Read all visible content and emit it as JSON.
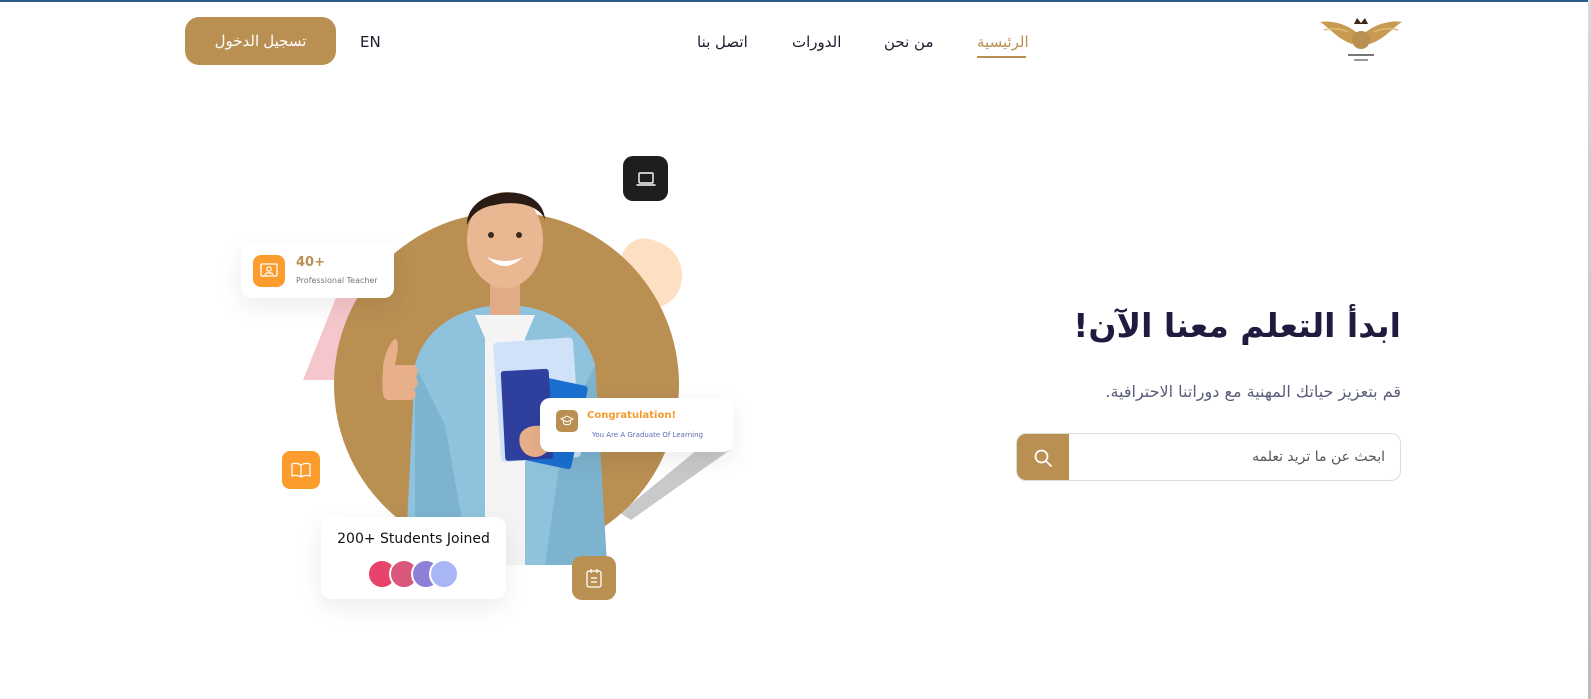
{
  "header": {
    "logo_name": "crown-wings-logo",
    "nav": [
      {
        "label": "الرئيسية",
        "active": true
      },
      {
        "label": "من نحن",
        "active": false
      },
      {
        "label": "الدورات",
        "active": false
      },
      {
        "label": "اتصل بنا",
        "active": false
      }
    ],
    "lang": "EN",
    "login_label": "تسجيل الدخول"
  },
  "hero": {
    "title": "ابدأ التعلم معنا الآن!",
    "subtitle": "قم بتعزيز حياتك المهنية مع دوراتنا الاحترافية.",
    "search": {
      "placeholder": "ابحث عن ما تريد تعلمه",
      "button_icon": "search-icon"
    }
  },
  "illustration": {
    "teacher_card": {
      "count": "40+",
      "label": "Professional Teacher"
    },
    "congrats_card": {
      "title": "Congratulation!",
      "subtitle": "You Are A Graduate Of Learning"
    },
    "students_card": {
      "label": "200+ Students Joined"
    }
  },
  "colors": {
    "accent": "#b98f52",
    "orange": "#fb9c2c",
    "dark": "#1f1a3e"
  }
}
